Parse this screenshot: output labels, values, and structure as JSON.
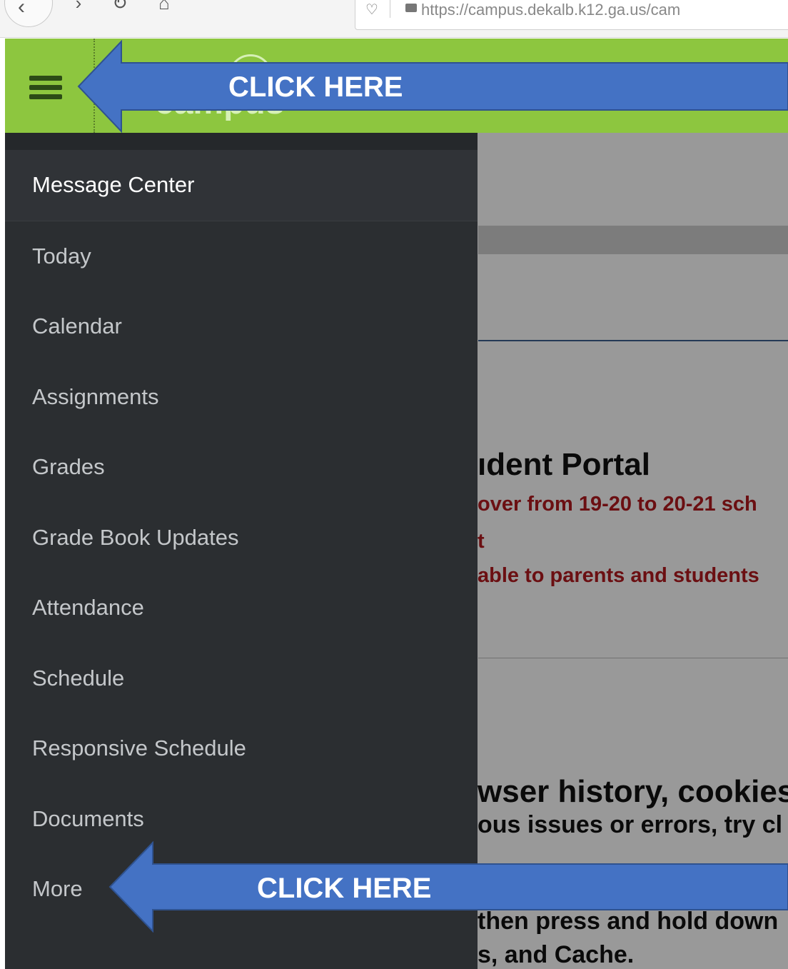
{
  "browser": {
    "url": "https://campus.dekalb.k12.ga.us/cam"
  },
  "app_header": {
    "logo_text": "campus"
  },
  "menu": {
    "items": [
      {
        "label": "Message Center"
      },
      {
        "label": "Today"
      },
      {
        "label": "Calendar"
      },
      {
        "label": "Assignments"
      },
      {
        "label": "Grades"
      },
      {
        "label": "Grade Book Updates"
      },
      {
        "label": "Attendance"
      },
      {
        "label": "Schedule"
      },
      {
        "label": "Responsive Schedule"
      },
      {
        "label": "Documents"
      },
      {
        "label": "More"
      }
    ]
  },
  "content": {
    "heading_portal": "ıdent Portal",
    "notice_line1": "over from 19-20 to 20-21 sch",
    "notice_fragment": "t",
    "notice_line2": "able to parents and students",
    "heading_browser": "wser history, cookies",
    "text_line1": "ous issues or errors, try cl",
    "text_line2": "then press and hold down",
    "text_line3": "s, and Cache."
  },
  "annotations": {
    "top_arrow_label": "CLICK HERE",
    "bottom_arrow_label": "CLICK HERE"
  },
  "colors": {
    "header_green": "#8dc63f",
    "drawer_bg": "#2b2e31",
    "arrow_blue": "#4472c4",
    "notice_red": "#b3191f"
  }
}
